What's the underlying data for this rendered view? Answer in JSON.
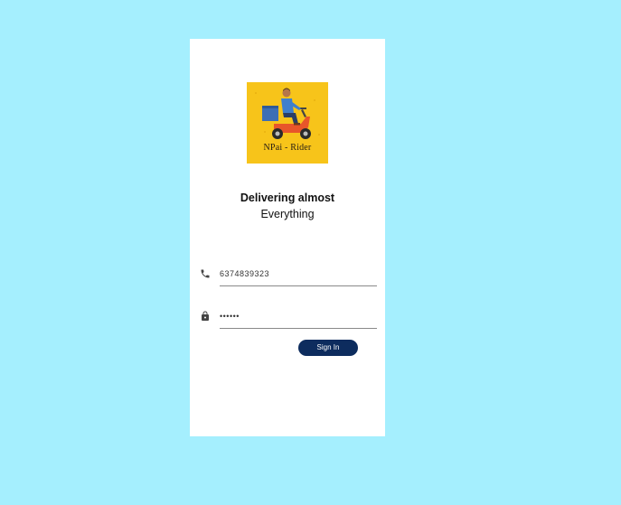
{
  "app": {
    "logo_text": "NPai - Rider",
    "tagline_line1": "Delivering almost",
    "tagline_line2": "Everything"
  },
  "form": {
    "phone": {
      "icon": "phone-icon",
      "value": "6374839323"
    },
    "password": {
      "icon": "lock-icon",
      "value": "••••••"
    },
    "signin_label": "Sign In"
  },
  "colors": {
    "background": "#a5effe",
    "card": "#ffffff",
    "logo_background": "#f7c41a",
    "button": "#0d2c5e"
  }
}
